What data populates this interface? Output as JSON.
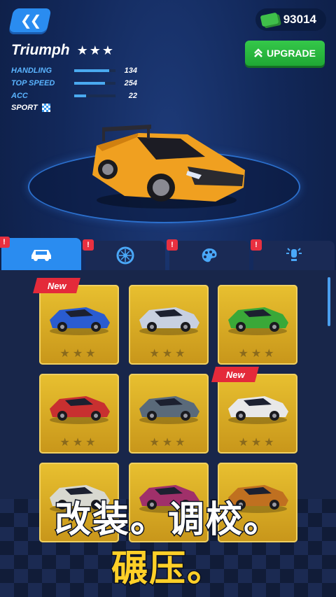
{
  "header": {
    "back_icon": "double-chevron-left-icon",
    "currency_icon": "cash-stack-icon",
    "currency_amount": "93014",
    "upgrade_label": "UPGRADE",
    "upgrade_icon": "double-chevron-up-icon"
  },
  "car": {
    "name": "Triumph",
    "stars": "★★★",
    "stats": [
      {
        "label": "HANDLING",
        "value": "134",
        "fill": 0.85
      },
      {
        "label": "TOP SPEED",
        "value": "254",
        "fill": 0.75
      },
      {
        "label": "ACC",
        "value": "22",
        "fill": 0.3
      }
    ],
    "class_label": "SPORT",
    "class_icon": "checkered-flag-icon"
  },
  "tabs": [
    {
      "icon": "car-icon",
      "badge": "!",
      "active": true
    },
    {
      "icon": "wheel-icon",
      "badge": "!",
      "active": false
    },
    {
      "icon": "paint-palette-icon",
      "badge": "!",
      "active": false
    },
    {
      "icon": "light-bulb-icon",
      "badge": "!",
      "active": false
    }
  ],
  "cards": [
    {
      "stars": "★★★",
      "tag": "New",
      "car_color": "#2a5cd0"
    },
    {
      "stars": "★★★",
      "tag": "",
      "car_color": "#c8d0e0"
    },
    {
      "stars": "★★★",
      "tag": "",
      "car_color": "#3aa838"
    },
    {
      "stars": "★★★",
      "tag": "",
      "car_color": "#c83030"
    },
    {
      "stars": "★★★",
      "tag": "",
      "car_color": "#5a6a7a"
    },
    {
      "stars": "★★★",
      "tag": "New",
      "car_color": "#e8e8e8"
    },
    {
      "stars": "",
      "tag": "",
      "car_color": "#d8d8d0"
    },
    {
      "stars": "",
      "tag": "",
      "car_color": "#a0306a"
    },
    {
      "stars": "",
      "tag": "",
      "car_color": "#c07020"
    }
  ],
  "slogan": {
    "line1": "改装。调校。",
    "line2": "碾压。"
  },
  "colors": {
    "accent_blue": "#2a8cf0",
    "upgrade_green": "#1fa834",
    "card_gold": "#e0b028",
    "new_red": "#e42a3a",
    "hero_car_orange": "#f0a020"
  }
}
